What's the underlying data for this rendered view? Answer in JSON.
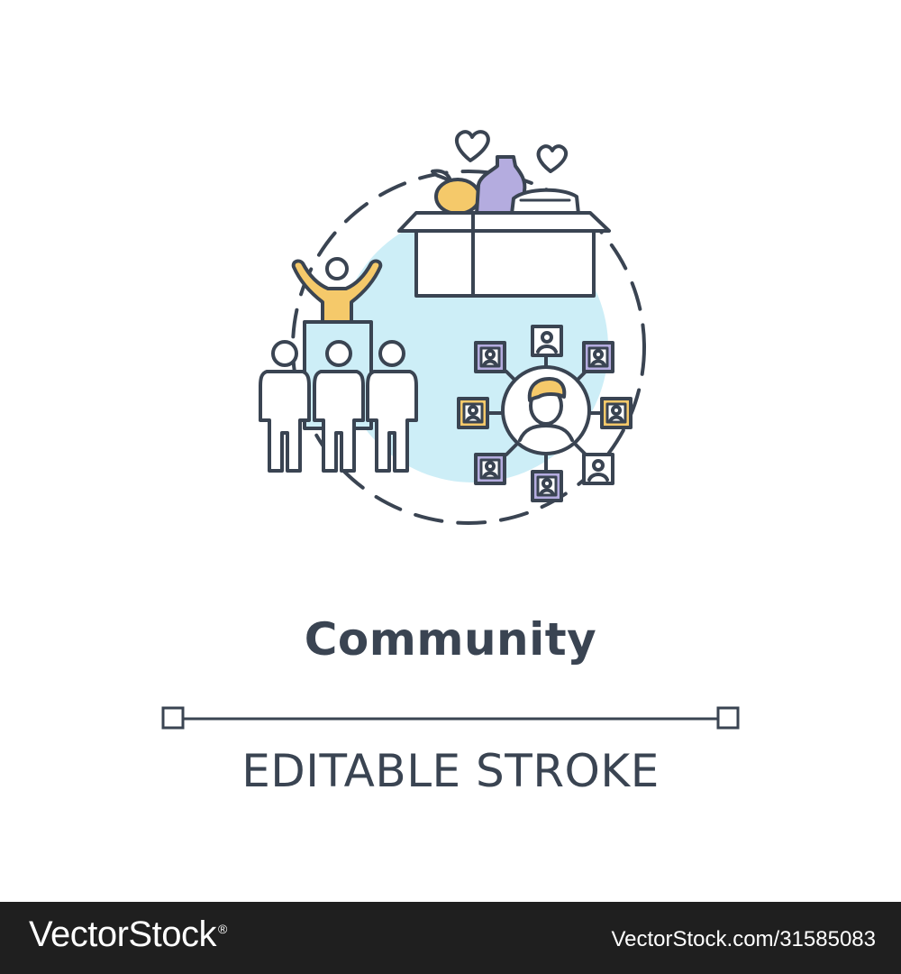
{
  "card": {
    "title": "Community",
    "subtitle": "EDITABLE STROKE"
  },
  "footer": {
    "brand": "VectorStock",
    "registered_mark": "®",
    "stock_id": "VectorStock.com/31585083"
  },
  "colors": {
    "stroke": "#3a4452",
    "accent_blue": "#cdeef7",
    "accent_yellow": "#f5c96a",
    "accent_purple": "#b4acdf",
    "footer_bg": "#1f1f1f"
  },
  "icons": [
    "dashed-circle",
    "donation-box-icon",
    "heart-icon",
    "crowd-icon",
    "network-icon"
  ]
}
